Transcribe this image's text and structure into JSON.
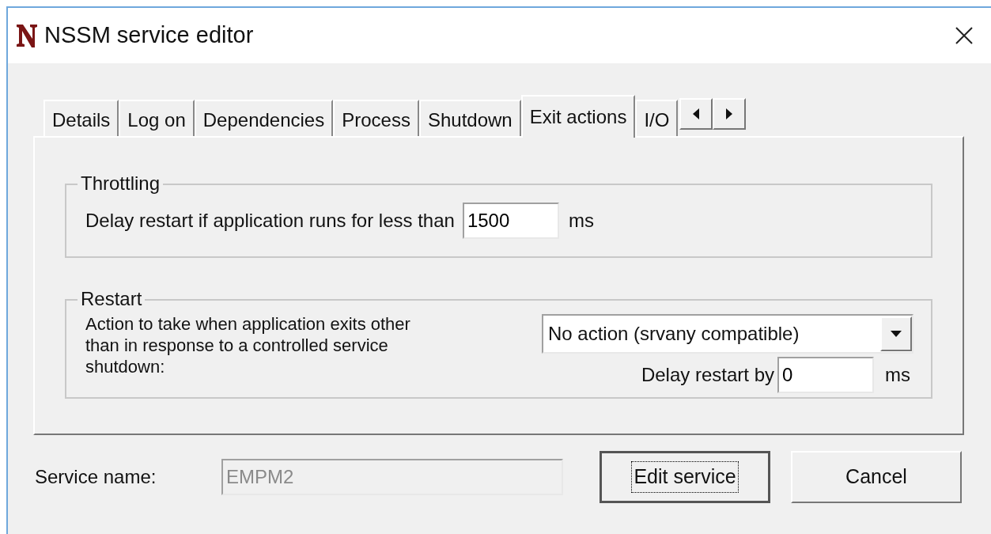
{
  "window": {
    "title": "NSSM service editor"
  },
  "tabs": [
    {
      "label": "Details",
      "selected": false
    },
    {
      "label": "Log on",
      "selected": false
    },
    {
      "label": "Dependencies",
      "selected": false
    },
    {
      "label": "Process",
      "selected": false
    },
    {
      "label": "Shutdown",
      "selected": false
    },
    {
      "label": "Exit actions",
      "selected": true
    },
    {
      "label": "I/O",
      "selected": false
    }
  ],
  "throttling": {
    "title": "Throttling",
    "label": "Delay restart if application runs for less than",
    "value": "1500",
    "unit": "ms"
  },
  "restart": {
    "title": "Restart",
    "description": "Action to take when application exits other than in response to a controlled service shutdown:",
    "action": "No action (srvany compatible)",
    "delay_label": "Delay restart by",
    "delay_value": "0",
    "unit": "ms"
  },
  "service_name": {
    "label": "Service name:",
    "value": "EMPM2",
    "disabled": true
  },
  "buttons": [
    {
      "label": "Edit service",
      "focused": true
    },
    {
      "label": "Cancel",
      "focused": false
    }
  ]
}
